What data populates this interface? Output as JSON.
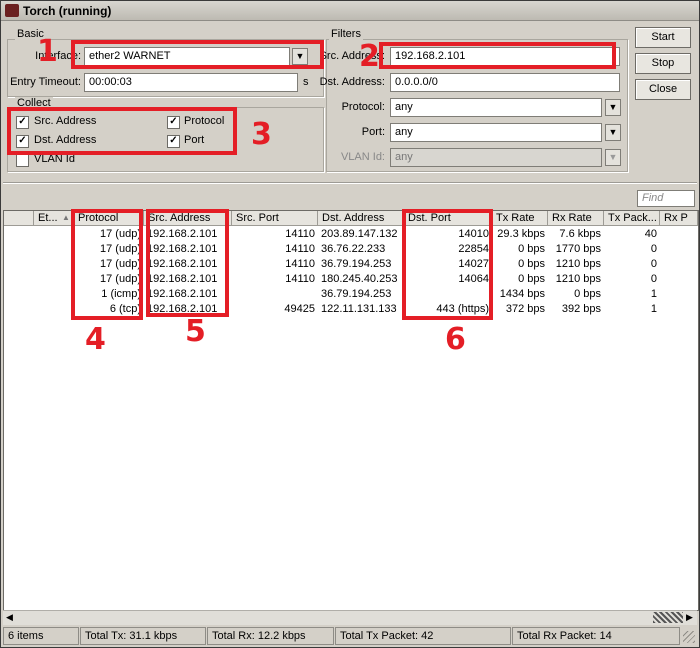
{
  "window": {
    "title": "Torch (running)"
  },
  "basic": {
    "group_label": "Basic",
    "interface_label": "Interface:",
    "interface_value": "ether2 WARNET",
    "entry_timeout_label": "Entry Timeout:",
    "entry_timeout_value": "00:00:03",
    "entry_timeout_unit": "s"
  },
  "collect": {
    "group_label": "Collect",
    "options": [
      {
        "label": "Src. Address",
        "checked": true
      },
      {
        "label": "Protocol",
        "checked": true
      },
      {
        "label": "Dst. Address",
        "checked": true
      },
      {
        "label": "Port",
        "checked": true
      },
      {
        "label": "VLAN Id",
        "checked": false
      }
    ]
  },
  "filters": {
    "group_label": "Filters",
    "src_address_label": "Src. Address:",
    "src_address_value": "192.168.2.101",
    "dst_address_label": "Dst. Address:",
    "dst_address_value": "0.0.0.0/0",
    "protocol_label": "Protocol:",
    "protocol_value": "any",
    "port_label": "Port:",
    "port_value": "any",
    "vlan_label": "VLAN Id:",
    "vlan_value": "any"
  },
  "buttons": {
    "start": "Start",
    "stop": "Stop",
    "close": "Close"
  },
  "find_placeholder": "Find",
  "table": {
    "headers": [
      "Et...",
      "Protocol",
      "Src. Address",
      "Src. Port",
      "Dst. Address",
      "Dst. Port",
      "Tx Rate",
      "Rx Rate",
      "Tx Pack...",
      "Rx P"
    ],
    "rows": [
      [
        "",
        "17 (udp)",
        "192.168.2.101",
        "14110",
        "203.89.147.132",
        "14010",
        "29.3 kbps",
        "7.6 kbps",
        "40",
        ""
      ],
      [
        "",
        "17 (udp)",
        "192.168.2.101",
        "14110",
        "36.76.22.233",
        "22854",
        "0 bps",
        "1770 bps",
        "0",
        ""
      ],
      [
        "",
        "17 (udp)",
        "192.168.2.101",
        "14110",
        "36.79.194.253",
        "14027",
        "0 bps",
        "1210 bps",
        "0",
        ""
      ],
      [
        "",
        "17 (udp)",
        "192.168.2.101",
        "14110",
        "180.245.40.253",
        "14064",
        "0 bps",
        "1210 bps",
        "0",
        ""
      ],
      [
        "",
        "1 (icmp)",
        "192.168.2.101",
        "",
        "36.79.194.253",
        "",
        "1434 bps",
        "0 bps",
        "1",
        ""
      ],
      [
        "",
        "6 (tcp)",
        "192.168.2.101",
        "49425",
        "122.11.131.133",
        "443 (https)",
        "372 bps",
        "392 bps",
        "1",
        ""
      ]
    ]
  },
  "status": {
    "items": "6 items",
    "total_tx": "Total Tx: 31.1 kbps",
    "total_rx": "Total Rx: 12.2 kbps",
    "total_tx_packet": "Total Tx Packet: 42",
    "total_rx_packet": "Total Rx Packet: 14"
  },
  "annotations": {
    "labels": [
      "1",
      "2",
      "3",
      "4",
      "5",
      "6"
    ],
    "color": "#e41e26"
  }
}
